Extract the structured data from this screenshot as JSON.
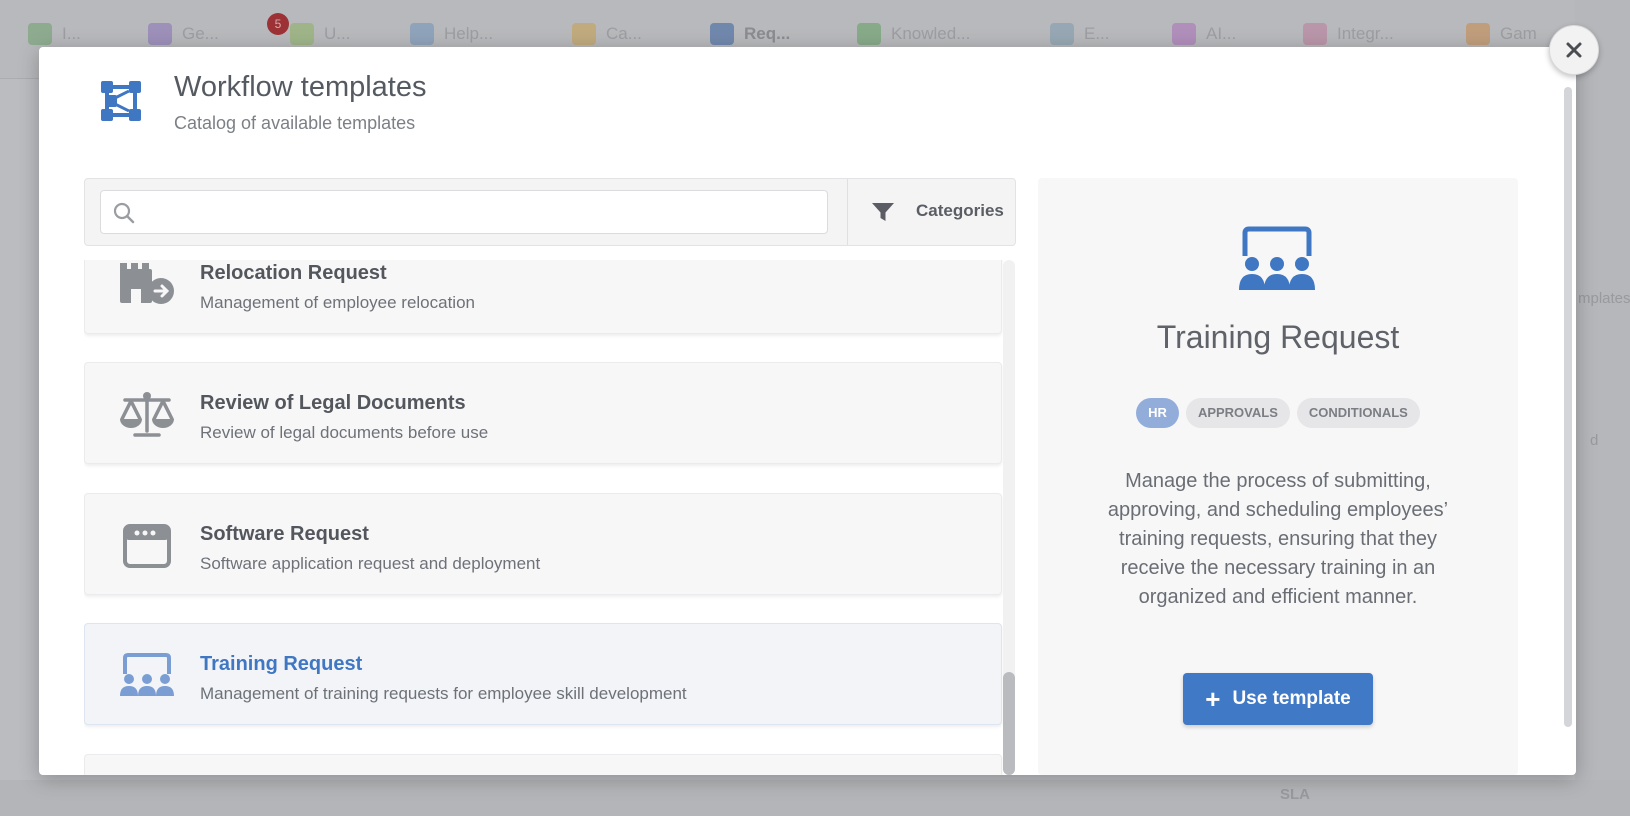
{
  "background": {
    "toolbar_items": [
      {
        "label": "I..."
      },
      {
        "label": "Ge..."
      },
      {
        "label": "U..."
      },
      {
        "label": "Help..."
      },
      {
        "label": "Ca..."
      },
      {
        "label": "Req..."
      },
      {
        "label": "Knowled..."
      },
      {
        "label": "E..."
      },
      {
        "label": "AI..."
      },
      {
        "label": "Integr..."
      },
      {
        "label": "Gam"
      }
    ],
    "notification_count": "5",
    "side_fragments": [
      "mplates",
      "d"
    ],
    "bottom_label": "SLA"
  },
  "modal": {
    "title": "Workflow templates",
    "subtitle": "Catalog of available templates",
    "search": {
      "placeholder": "",
      "value": ""
    },
    "categories_label": "Categories",
    "templates": [
      {
        "title": "Relocation Request",
        "description": "Management of employee relocation",
        "icon": "relocation-icon"
      },
      {
        "title": "Review of Legal Documents",
        "description": "Review of legal documents before use",
        "icon": "scales-icon"
      },
      {
        "title": "Software Request",
        "description": "Software application request and deployment",
        "icon": "browser-window-icon"
      },
      {
        "title": "Training Request",
        "description": "Management of training requests for employee skill development",
        "icon": "training-icon",
        "selected": true
      }
    ],
    "detail": {
      "title": "Training Request",
      "tags": [
        "HR",
        "APPROVALS",
        "CONDITIONALS"
      ],
      "description": "Manage the process of submitting, approving, and scheduling employees’ training requests, ensuring that they receive the necessary training in an organized and efficient manner.",
      "button_label": "Use template"
    }
  },
  "colors": {
    "accent": "#4079c6",
    "selected_title": "#3f77c2",
    "tag_active": "#93addb",
    "notification_badge": "#a52326"
  }
}
